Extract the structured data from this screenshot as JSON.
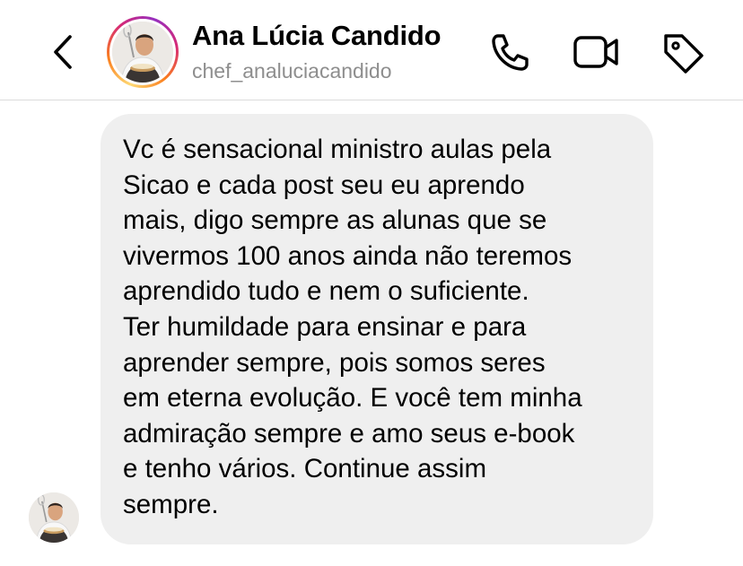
{
  "header": {
    "back_icon": "chevron-left-icon",
    "name": "Ana Lúcia Candido",
    "username": "chef_analuciacandido",
    "actions": [
      {
        "icon": "phone-icon"
      },
      {
        "icon": "video-camera-icon"
      },
      {
        "icon": "tag-icon"
      }
    ]
  },
  "thread": {
    "message": "Vc é sensacional ministro aulas pela\nSicao e cada post seu eu aprendo\nmais, digo sempre as alunas que se\nvivermos 100 anos ainda não teremos\naprendido tudo e nem o suficiente.\nTer humildade para ensinar e para\naprender sempre, pois somos seres\nem eterna evolução. E você tem minha\nadmiração sempre e amo seus e-book\ne tenho vários. Continue assim\nsempre.",
    "bubble_color": "#efefef"
  },
  "colors": {
    "username_gray": "#8e8e8e",
    "divider": "#dbdbdb",
    "story_ring": [
      "#feda75",
      "#fa7e1e",
      "#d62976",
      "#962fbf"
    ]
  }
}
